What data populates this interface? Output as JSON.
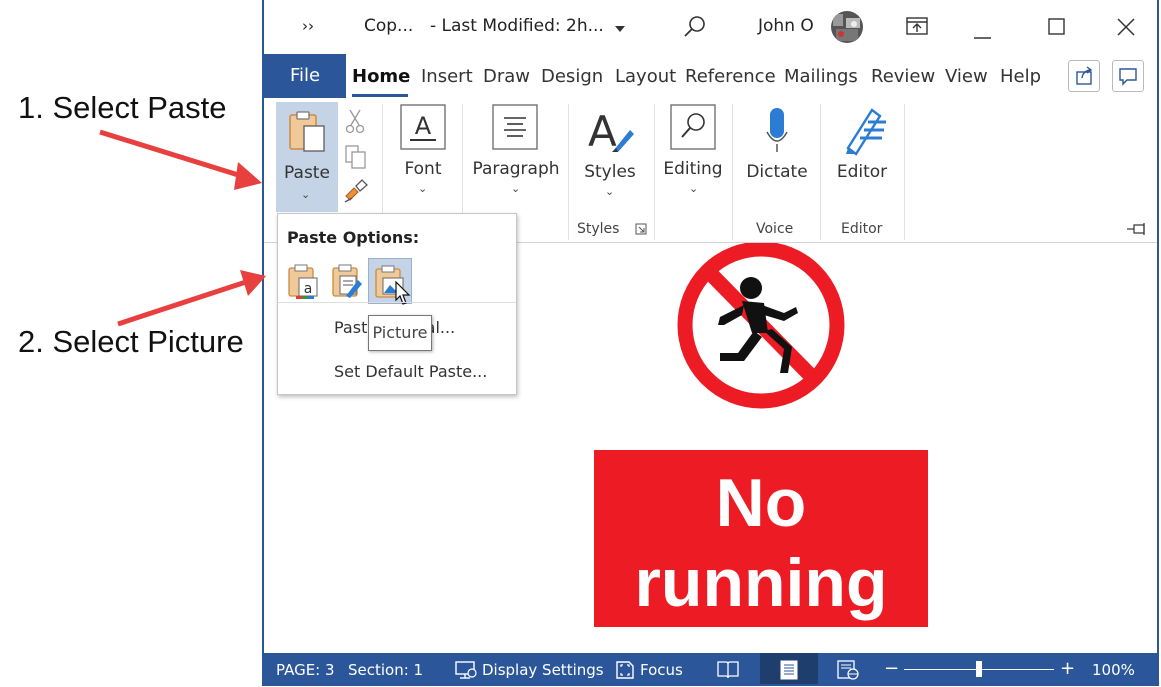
{
  "annotations": {
    "step1": "1. Select Paste",
    "step2": "2. Select Picture",
    "arrow_color": "#e8403f"
  },
  "titlebar": {
    "quick_access": "››",
    "doc_title": "Cop...",
    "last_modified": "- Last Modified: 2h...",
    "user_name": "John O",
    "icons": [
      "search-icon",
      "ribbon-display-options-icon",
      "minimize-icon",
      "maximize-icon",
      "close-icon"
    ]
  },
  "tabs": {
    "file": "File",
    "items": [
      "Home",
      "Insert",
      "Draw",
      "Design",
      "Layout",
      "References",
      "Mailings",
      "Review",
      "View",
      "Help"
    ],
    "active": "Home"
  },
  "ribbon": {
    "paste": "Paste",
    "font": "Font",
    "paragraph": "Paragraph",
    "styles": "Styles",
    "editing": "Editing",
    "dictate": "Dictate",
    "editor": "Editor",
    "group_styles": "Styles",
    "group_voice": "Voice",
    "group_editor": "Editor"
  },
  "paste_menu": {
    "title": "Paste Options:",
    "options": [
      "keep-source-formatting-icon",
      "merge-formatting-icon",
      "picture-paste-icon"
    ],
    "paste_special": "Paste Special...",
    "set_default": "Set Default Paste...",
    "tooltip": "Picture"
  },
  "document": {
    "sign_line1": "No",
    "sign_line2": "running",
    "sign_color": "#ed1c24"
  },
  "statusbar": {
    "page": "PAGE: 3",
    "section": "Section: 1",
    "display_settings": "Display Settings",
    "focus": "Focus",
    "zoom_minus": "−",
    "zoom_plus": "+",
    "zoom": "100%",
    "zoom_fraction": 0.5
  },
  "colors": {
    "accent": "#2b579a",
    "hover": "#c5d3e6"
  }
}
